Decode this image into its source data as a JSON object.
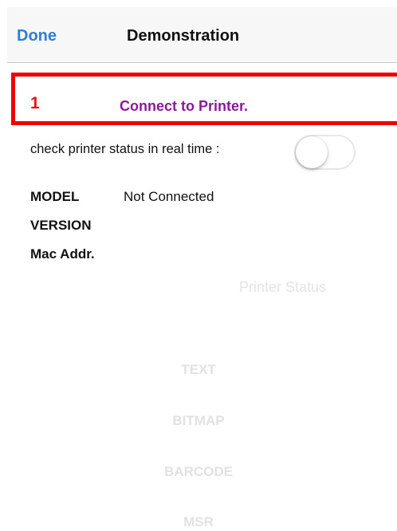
{
  "nav": {
    "done_label": "Done",
    "title": "Demonstration"
  },
  "connect": {
    "step_number": "1",
    "label": "Connect to Printer."
  },
  "status_check": {
    "label": "check printer status in real time :",
    "enabled": false
  },
  "info": {
    "model_label": "MODEL",
    "model_value": "Not Connected",
    "version_label": "VERSION",
    "mac_label": "Mac Addr."
  },
  "printer_status_label": "Printer Status",
  "actions": {
    "text": "TEXT",
    "bitmap": "BITMAP",
    "barcode": "BARCODE",
    "msr": "MSR"
  },
  "colors": {
    "nav_tint": "#2f7fd6",
    "highlight_border": "#ee0000",
    "step_number": "#e8120e",
    "connect_label": "#8a1a97",
    "disabled_text": "#e2e2e2"
  }
}
